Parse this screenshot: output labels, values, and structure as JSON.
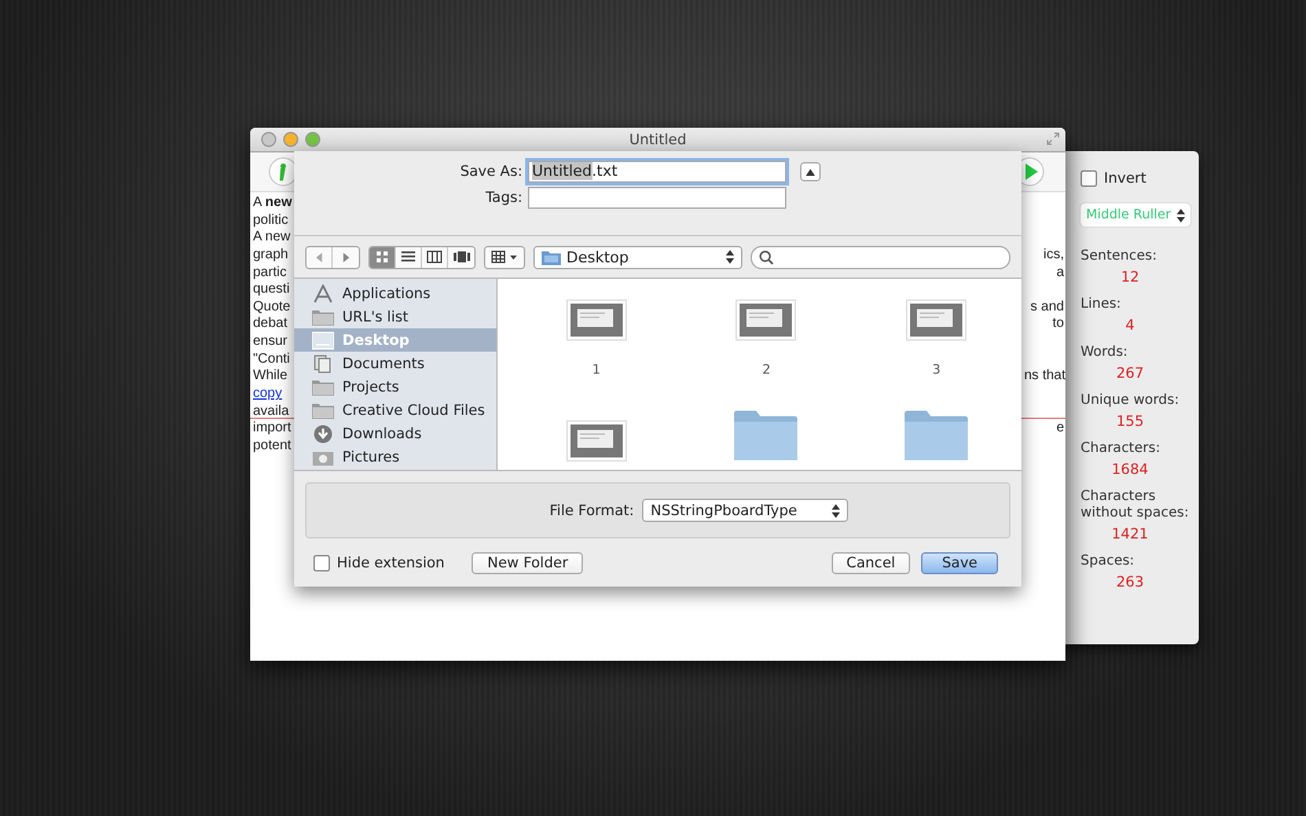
{
  "window": {
    "title": "Untitled"
  },
  "document": {
    "lines": [
      {
        "left": "A **new**"
      },
      {
        "left": "politic"
      },
      {
        "left": "A new"
      },
      {
        "left": "graph",
        "right": "ics,"
      },
      {
        "left": "partic",
        "right": "a"
      },
      {
        "left": "questi"
      },
      {
        "left": "Quote",
        "right": "s and"
      },
      {
        "left": "debat",
        "right": "to"
      },
      {
        "left": "ensur"
      },
      {
        "left": "\"Conti"
      },
      {
        "left": "While",
        "right": "ns that"
      },
      {
        "left": "copy",
        "kind": "link"
      },
      {
        "left": "availa"
      },
      {
        "left": "import",
        "right": "e"
      },
      {
        "left": "potent"
      }
    ]
  },
  "save_sheet": {
    "save_as_label": "Save As:",
    "file_name": "Untitled",
    "extension": ".txt",
    "tags_label": "Tags:",
    "views": [
      {
        "kind": "icons",
        "selected": true
      },
      {
        "kind": "list",
        "selected": false
      },
      {
        "kind": "columns",
        "selected": false
      },
      {
        "kind": "coverflow",
        "selected": false
      }
    ],
    "location": "Desktop",
    "sidebar": [
      {
        "label": "Applications",
        "kind": "apps",
        "selected": false
      },
      {
        "label": "URL's list",
        "kind": "folder",
        "selected": false
      },
      {
        "label": "Desktop",
        "kind": "desktop",
        "selected": true
      },
      {
        "label": "Documents",
        "kind": "documents",
        "selected": false
      },
      {
        "label": "Projects",
        "kind": "folder",
        "selected": false
      },
      {
        "label": "Creative Cloud Files",
        "kind": "folder",
        "selected": false
      },
      {
        "label": "Downloads",
        "kind": "downloads",
        "selected": false
      },
      {
        "label": "Pictures",
        "kind": "pictures",
        "selected": false
      }
    ],
    "files": [
      {
        "kind": "screenshot",
        "label": "1"
      },
      {
        "kind": "screenshot",
        "label": "2"
      },
      {
        "kind": "screenshot",
        "label": "3"
      },
      {
        "kind": "screenshot"
      },
      {
        "kind": "folder"
      },
      {
        "kind": "folder"
      }
    ],
    "format_label": "File Format:",
    "format": "NSStringPboardType",
    "hide_extension": {
      "label": "Hide extension",
      "checked": false
    },
    "buttons": [
      {
        "label": "New Folder",
        "kind": "left"
      },
      {
        "label": "Cancel",
        "kind": "normal"
      },
      {
        "label": "Save",
        "kind": "default"
      }
    ]
  },
  "stats_panel": {
    "invert": {
      "label": "Invert",
      "checked": false
    },
    "ruler": "Middle Ruller",
    "stats": [
      {
        "label": "Sentences:",
        "value": "12"
      },
      {
        "label": "Lines:",
        "value": "4"
      },
      {
        "label": "Words:",
        "value": "267"
      },
      {
        "label": "Unique words:",
        "value": "155"
      },
      {
        "label": "Characters:",
        "value": "1684"
      },
      {
        "label": "Characters without spaces:",
        "value": "1421"
      },
      {
        "label": "Spaces:",
        "value": "263"
      }
    ]
  }
}
